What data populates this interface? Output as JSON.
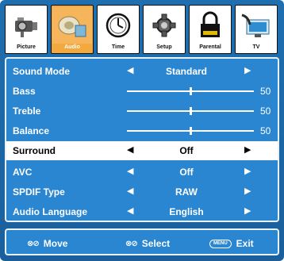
{
  "tabs": [
    {
      "label": "Picture",
      "icon": "camera-icon"
    },
    {
      "label": "Audio",
      "icon": "speaker-icon"
    },
    {
      "label": "Time",
      "icon": "clock-icon"
    },
    {
      "label": "Setup",
      "icon": "gear-icon"
    },
    {
      "label": "Parental",
      "icon": "lock-icon"
    },
    {
      "label": "TV",
      "icon": "satellite-dish-icon"
    }
  ],
  "active_tab": "Audio",
  "menu": {
    "sound_mode": {
      "label": "Sound Mode",
      "value": "Standard"
    },
    "bass": {
      "label": "Bass",
      "value": "50",
      "level": 0.5
    },
    "treble": {
      "label": "Treble",
      "value": "50",
      "level": 0.5
    },
    "balance": {
      "label": "Balance",
      "value": "50",
      "level": 0.5
    },
    "surround": {
      "label": "Surround",
      "value": "Off"
    },
    "avc": {
      "label": "AVC",
      "value": "Off"
    },
    "spdif": {
      "label": "SPDIF Type",
      "value": "RAW"
    },
    "audio_language": {
      "label": "Audio Language",
      "value": "English"
    }
  },
  "selected_item": "Surround",
  "footer": {
    "move_label": "Move",
    "select_label": "Select",
    "menu_key": "MENU",
    "exit_label": "Exit"
  },
  "colors": {
    "frame": "#1f6fb0",
    "panel": "#2a86d1",
    "active_tab": "#f3a93e",
    "selected_row": "#ffffff"
  }
}
